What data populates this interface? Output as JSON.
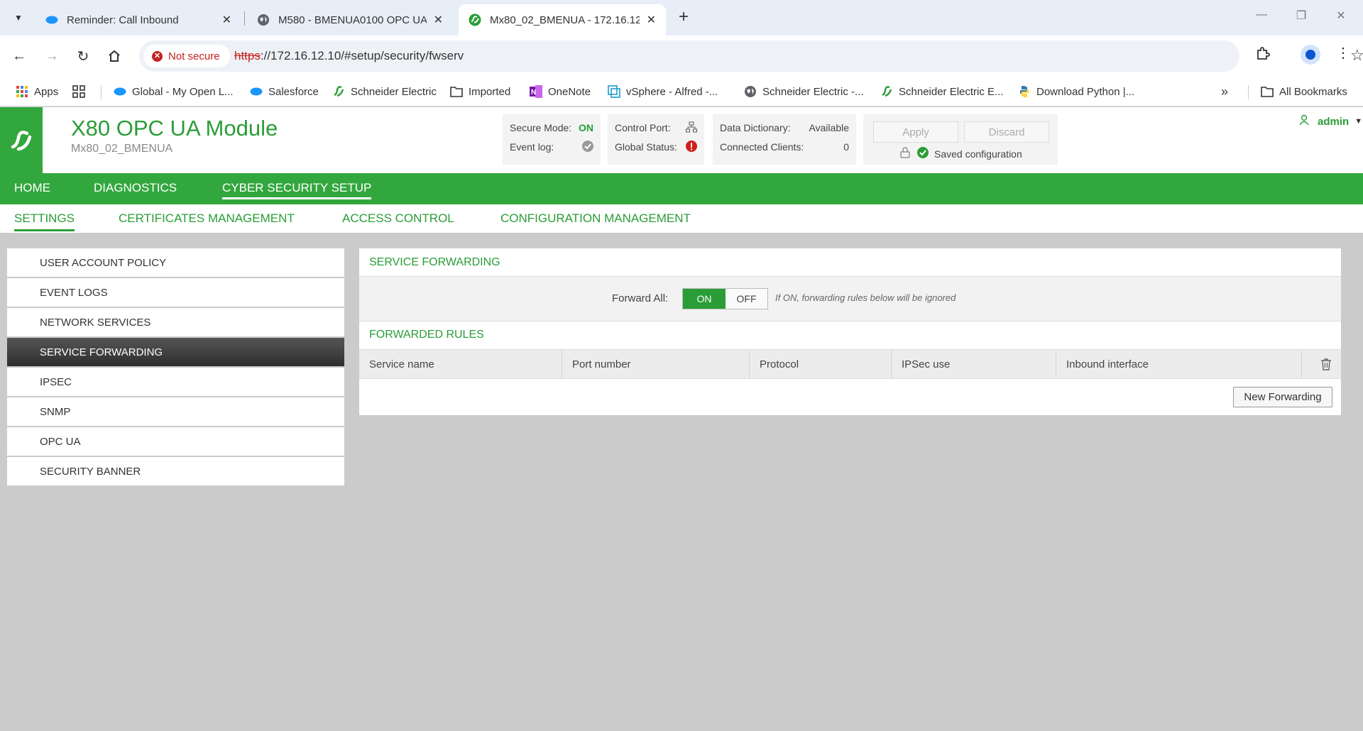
{
  "browser": {
    "tabs": [
      {
        "title": "Reminder: Call Inbound",
        "icon": "salesforce-cloud-icon"
      },
      {
        "title": "M580 - BMENUA0100 OPC UA",
        "icon": "globe-icon"
      },
      {
        "title": "Mx80_02_BMENUA - 172.16.12.",
        "icon": "schneider-icon"
      }
    ],
    "security_chip": "Not secure",
    "url_scheme": "https",
    "url_rest": "://172.16.12.10/#setup/security/fwserv",
    "bookmarks": [
      {
        "label": "Apps",
        "icon": "apps-grid-icon"
      },
      {
        "label": "",
        "icon": "tab-groups-icon"
      },
      {
        "label": "Global - My Open L...",
        "icon": "salesforce-cloud-icon"
      },
      {
        "label": "Salesforce",
        "icon": "salesforce-cloud-icon"
      },
      {
        "label": "Schneider Electric",
        "icon": "schneider-icon"
      },
      {
        "label": "Imported",
        "icon": "folder-icon"
      },
      {
        "label": "OneNote",
        "icon": "onenote-icon"
      },
      {
        "label": "vSphere - Alfred -...",
        "icon": "vsphere-icon"
      },
      {
        "label": "Schneider Electric -...",
        "icon": "globe-icon"
      },
      {
        "label": "Schneider Electric E...",
        "icon": "schneider-icon"
      },
      {
        "label": "Download Python |...",
        "icon": "python-icon"
      }
    ],
    "all_bookmarks": "All Bookmarks"
  },
  "app": {
    "title": "X80 OPC UA Module",
    "subtitle": "Mx80_02_BMENUA",
    "status": {
      "secure_mode_label": "Secure Mode:",
      "secure_mode_value": "ON",
      "event_log_label": "Event log:",
      "control_port_label": "Control Port:",
      "global_status_label": "Global Status:",
      "data_dictionary_label": "Data Dictionary:",
      "data_dictionary_value": "Available",
      "connected_clients_label": "Connected Clients:",
      "connected_clients_value": "0"
    },
    "apply_label": "Apply",
    "discard_label": "Discard",
    "saved_config": "Saved configuration",
    "user": "admin"
  },
  "main_nav": [
    "HOME",
    "DIAGNOSTICS",
    "CYBER SECURITY SETUP"
  ],
  "sub_nav": [
    "SETTINGS",
    "CERTIFICATES MANAGEMENT",
    "ACCESS CONTROL",
    "CONFIGURATION MANAGEMENT"
  ],
  "sidebar": [
    "USER ACCOUNT POLICY",
    "EVENT LOGS",
    "NETWORK SERVICES",
    "SERVICE FORWARDING",
    "IPSEC",
    "SNMP",
    "OPC UA",
    "SECURITY BANNER"
  ],
  "service_forwarding": {
    "title": "SERVICE FORWARDING",
    "forward_all_label": "Forward All:",
    "on_label": "ON",
    "off_label": "OFF",
    "hint": "If ON, forwarding rules below will be ignored"
  },
  "forwarded_rules": {
    "title": "FORWARDED RULES",
    "columns": [
      "Service name",
      "Port number",
      "Protocol",
      "IPSec use",
      "Inbound interface"
    ],
    "new_button": "New Forwarding"
  }
}
